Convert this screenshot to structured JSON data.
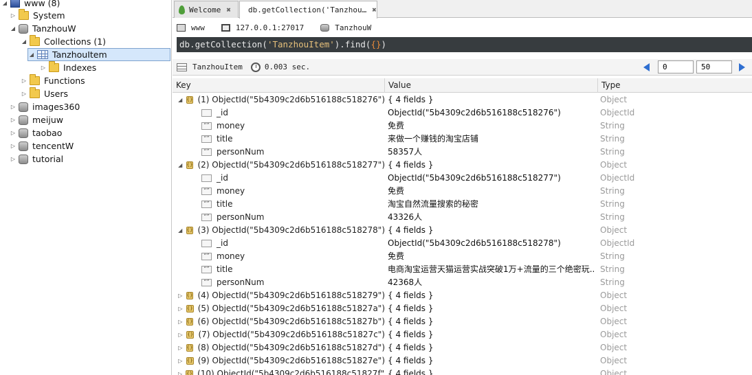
{
  "tree": {
    "root": "www (8)",
    "items": [
      {
        "label": "System",
        "kind": "folder",
        "expanded": false
      },
      {
        "label": "TanzhouW",
        "kind": "db",
        "expanded": true
      },
      {
        "label": "Collections (1)",
        "kind": "folder",
        "expanded": true
      },
      {
        "label": "TanzhouItem",
        "kind": "collection",
        "expanded": true,
        "selected": true
      },
      {
        "label": "Indexes",
        "kind": "folder",
        "expanded": false
      },
      {
        "label": "Functions",
        "kind": "folder",
        "expanded": false
      },
      {
        "label": "Users",
        "kind": "folder",
        "expanded": false
      },
      {
        "label": "images360",
        "kind": "db",
        "expanded": false
      },
      {
        "label": "meijuw",
        "kind": "db",
        "expanded": false
      },
      {
        "label": "taobao",
        "kind": "db",
        "expanded": false
      },
      {
        "label": "tencentW",
        "kind": "db",
        "expanded": false
      },
      {
        "label": "tutorial",
        "kind": "db",
        "expanded": false
      }
    ]
  },
  "tabs": [
    {
      "label": "Welcome",
      "active": false
    },
    {
      "label": "db.getCollection('Tanzhou…",
      "active": true
    }
  ],
  "connection": {
    "name": "www",
    "host": "127.0.0.1:27017",
    "database": "TanzhouW"
  },
  "query": {
    "prefix": "db.getCollection(",
    "arg": "'TanzhouItem'",
    "middle": ").find(",
    "braces": "{}",
    "suffix": ")"
  },
  "result": {
    "collection": "TanzhouItem",
    "time": "0.003 sec.",
    "skip": "0",
    "limit": "50"
  },
  "columns": {
    "key": "Key",
    "value": "Value",
    "type": "Type"
  },
  "rows": [
    {
      "level": 0,
      "expanded": true,
      "icon": "object",
      "key": "(1) ObjectId(\"5b4309c2d6b516188c518276\")",
      "value": "{ 4 fields }",
      "type": "Object"
    },
    {
      "level": 1,
      "icon": "oid",
      "key": "_id",
      "value": "ObjectId(\"5b4309c2d6b516188c518276\")",
      "type": "ObjectId"
    },
    {
      "level": 1,
      "icon": "string",
      "key": "money",
      "value": "免费",
      "type": "String"
    },
    {
      "level": 1,
      "icon": "string",
      "key": "title",
      "value": "来做一个赚钱的淘宝店铺",
      "type": "String"
    },
    {
      "level": 1,
      "icon": "string",
      "key": "personNum",
      "value": "58357人",
      "type": "String"
    },
    {
      "level": 0,
      "expanded": true,
      "icon": "object",
      "key": "(2) ObjectId(\"5b4309c2d6b516188c518277\")",
      "value": "{ 4 fields }",
      "type": "Object"
    },
    {
      "level": 1,
      "icon": "oid",
      "key": "_id",
      "value": "ObjectId(\"5b4309c2d6b516188c518277\")",
      "type": "ObjectId"
    },
    {
      "level": 1,
      "icon": "string",
      "key": "money",
      "value": "免费",
      "type": "String"
    },
    {
      "level": 1,
      "icon": "string",
      "key": "title",
      "value": "淘宝自然流量搜索的秘密",
      "type": "String"
    },
    {
      "level": 1,
      "icon": "string",
      "key": "personNum",
      "value": "43326人",
      "type": "String"
    },
    {
      "level": 0,
      "expanded": true,
      "icon": "object",
      "key": "(3) ObjectId(\"5b4309c2d6b516188c518278\")",
      "value": "{ 4 fields }",
      "type": "Object"
    },
    {
      "level": 1,
      "icon": "oid",
      "key": "_id",
      "value": "ObjectId(\"5b4309c2d6b516188c518278\")",
      "type": "ObjectId"
    },
    {
      "level": 1,
      "icon": "string",
      "key": "money",
      "value": "免费",
      "type": "String"
    },
    {
      "level": 1,
      "icon": "string",
      "key": "title",
      "value": "电商淘宝运营天猫运营实战突破1万+流量的三个绝密玩...",
      "type": "String"
    },
    {
      "level": 1,
      "icon": "string",
      "key": "personNum",
      "value": "42368人",
      "type": "String"
    },
    {
      "level": 0,
      "expanded": false,
      "icon": "object",
      "key": "(4) ObjectId(\"5b4309c2d6b516188c518279\")",
      "value": "{ 4 fields }",
      "type": "Object"
    },
    {
      "level": 0,
      "expanded": false,
      "icon": "object",
      "key": "(5) ObjectId(\"5b4309c2d6b516188c51827a\")",
      "value": "{ 4 fields }",
      "type": "Object"
    },
    {
      "level": 0,
      "expanded": false,
      "icon": "object",
      "key": "(6) ObjectId(\"5b4309c2d6b516188c51827b\")",
      "value": "{ 4 fields }",
      "type": "Object"
    },
    {
      "level": 0,
      "expanded": false,
      "icon": "object",
      "key": "(7) ObjectId(\"5b4309c2d6b516188c51827c\")",
      "value": "{ 4 fields }",
      "type": "Object"
    },
    {
      "level": 0,
      "expanded": false,
      "icon": "object",
      "key": "(8) ObjectId(\"5b4309c2d6b516188c51827d\")",
      "value": "{ 4 fields }",
      "type": "Object"
    },
    {
      "level": 0,
      "expanded": false,
      "icon": "object",
      "key": "(9) ObjectId(\"5b4309c2d6b516188c51827e\")",
      "value": "{ 4 fields }",
      "type": "Object"
    },
    {
      "level": 0,
      "expanded": false,
      "icon": "object",
      "key": "(10) ObjectId(\"5b4309c2d6b516188c51827f\")",
      "value": "{ 4 fields }",
      "type": "Object"
    }
  ]
}
